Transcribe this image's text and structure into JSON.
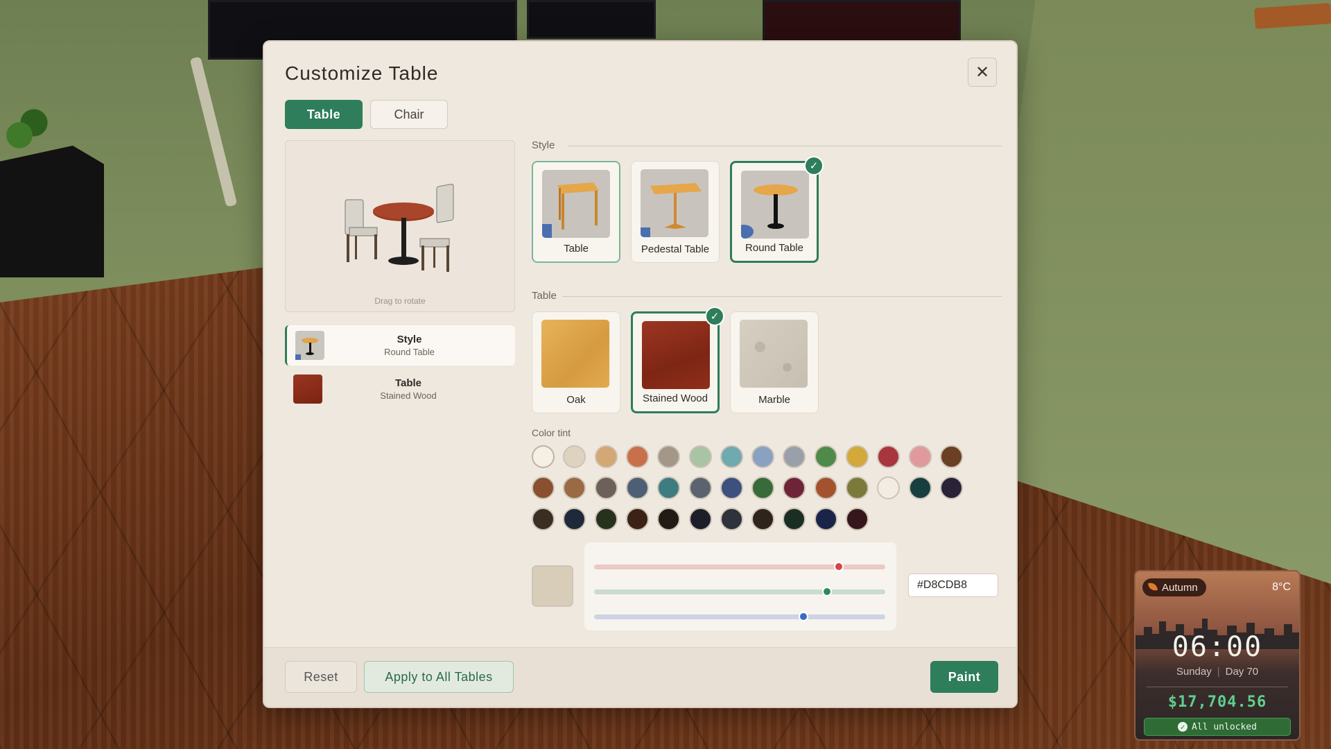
{
  "modal": {
    "title": "Customize Table",
    "close_glyph": "✕",
    "tabs": [
      {
        "label": "Table",
        "active": true
      },
      {
        "label": "Chair",
        "active": false
      }
    ],
    "preview_hint": "Drag to rotate",
    "summary": [
      {
        "title": "Style",
        "value": "Round Table"
      },
      {
        "title": "Table",
        "value": "Stained Wood"
      }
    ]
  },
  "style_section": {
    "label": "Style",
    "options": [
      {
        "label": "Table",
        "selected": false
      },
      {
        "label": "Pedestal Table",
        "selected": false
      },
      {
        "label": "Round Table",
        "selected": true
      }
    ]
  },
  "material_section": {
    "label": "Table",
    "options": [
      {
        "label": "Oak",
        "color": "#dca049",
        "selected": false
      },
      {
        "label": "Stained Wood",
        "color": "#8b2d1a",
        "selected": true
      },
      {
        "label": "Marble",
        "color": "#cfc8bc",
        "selected": false
      }
    ]
  },
  "color_tint": {
    "label": "Color tint",
    "swatches": [
      "#f6efe4",
      "#ddd3c0",
      "#d3a875",
      "#c8704a",
      "#a39888",
      "#a9c4a4",
      "#6eaab0",
      "#8aa2c2",
      "#9aa0aa",
      "#4f8a4a",
      "#d4a93c",
      "#a9353e",
      "#e09a9e",
      "#6a3f24",
      "#8a4f2e",
      "#9a6a44",
      "#6b605a",
      "#4d5f74",
      "#3e7c82",
      "#5a636e",
      "#3e507e",
      "#376b3a",
      "#6e2438",
      "#a4522e",
      "#7c7a3a",
      "#f2ece2",
      "#173f3f",
      "#2a2238",
      "#3a2e22",
      "#1e2a3a",
      "#26321e",
      "#3c2216",
      "#221a14",
      "#1c1e2a",
      "#2e323a",
      "#2e241c",
      "#1a2e24",
      "#1a2448",
      "#36161a"
    ],
    "custom_color": "#D8CDB8",
    "hex_value": "#D8CDB8",
    "sliders": [
      {
        "channel": "red",
        "value": 0.84,
        "track": "#ecc9c4",
        "knob": "#d64545"
      },
      {
        "channel": "green",
        "value": 0.8,
        "track": "#c9dccd",
        "knob": "#2e8b57"
      },
      {
        "channel": "blue",
        "value": 0.72,
        "track": "#cdd3e4",
        "knob": "#3a6ac4"
      }
    ]
  },
  "footer": {
    "reset_label": "Reset",
    "apply_label": "Apply to All Tables",
    "paint_label": "Paint"
  },
  "hud": {
    "season": "Autumn",
    "temperature": "8°C",
    "time": "06:00",
    "weekday": "Sunday",
    "day": "Day 70",
    "money": "$17,704.56",
    "unlock_text": "All unlocked",
    "unlock_glyph": "✓"
  },
  "check_glyph": "✓"
}
